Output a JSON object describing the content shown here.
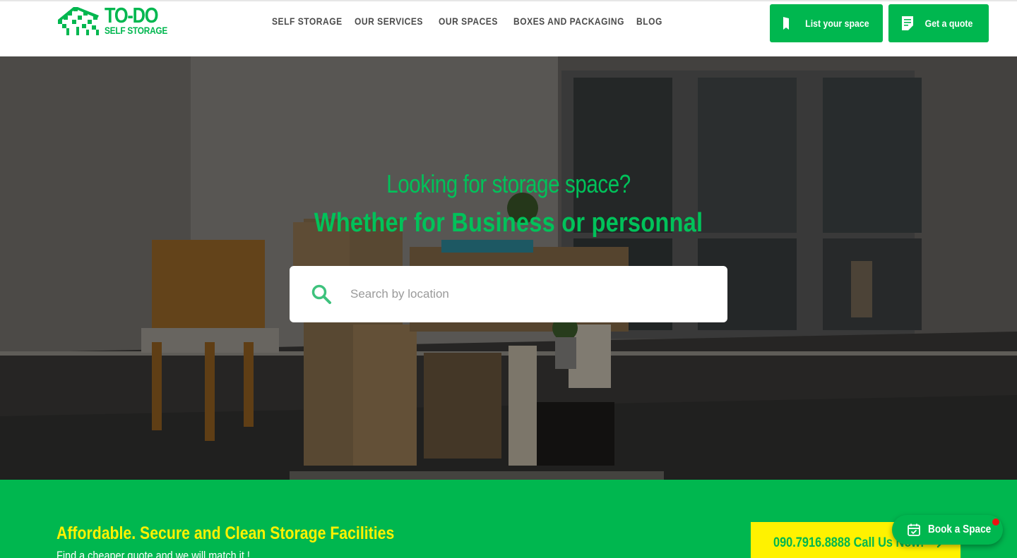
{
  "brand": {
    "name": "TO-DO",
    "tagline": "SELF STORAGE"
  },
  "nav": {
    "items": [
      {
        "label": "SELF STORAGE"
      },
      {
        "label": "OUR SERVICES"
      },
      {
        "label": "OUR SPACES"
      },
      {
        "label": "BOXES AND PACKAGING"
      },
      {
        "label": "BLOG"
      }
    ]
  },
  "header_buttons": {
    "list_space": {
      "label": "List your space",
      "icon": "bookmark-icon"
    },
    "get_quote": {
      "label": "Get a quote",
      "icon": "document-icon"
    }
  },
  "hero": {
    "heading": "Looking for storage space?",
    "subheading": "Whether for Business or personnal",
    "search": {
      "placeholder": "Search by location",
      "value": "",
      "icon": "search-icon"
    }
  },
  "band": {
    "title": "Affordable. Secure and Clean Storage Facilities",
    "text": "Find a cheaper quote and we will match it !",
    "call_button": {
      "label": "090.7916.8888 Call Us Now!",
      "icon": "arrow-right-icon"
    }
  },
  "floating": {
    "book_label": "Book a Space",
    "icon": "calendar-check-icon"
  },
  "colors": {
    "green": "#00b74f",
    "accent_green": "#00c25a",
    "yellow": "#fff200",
    "nav_text": "#4b4b4b",
    "notification": "#ee1111"
  }
}
